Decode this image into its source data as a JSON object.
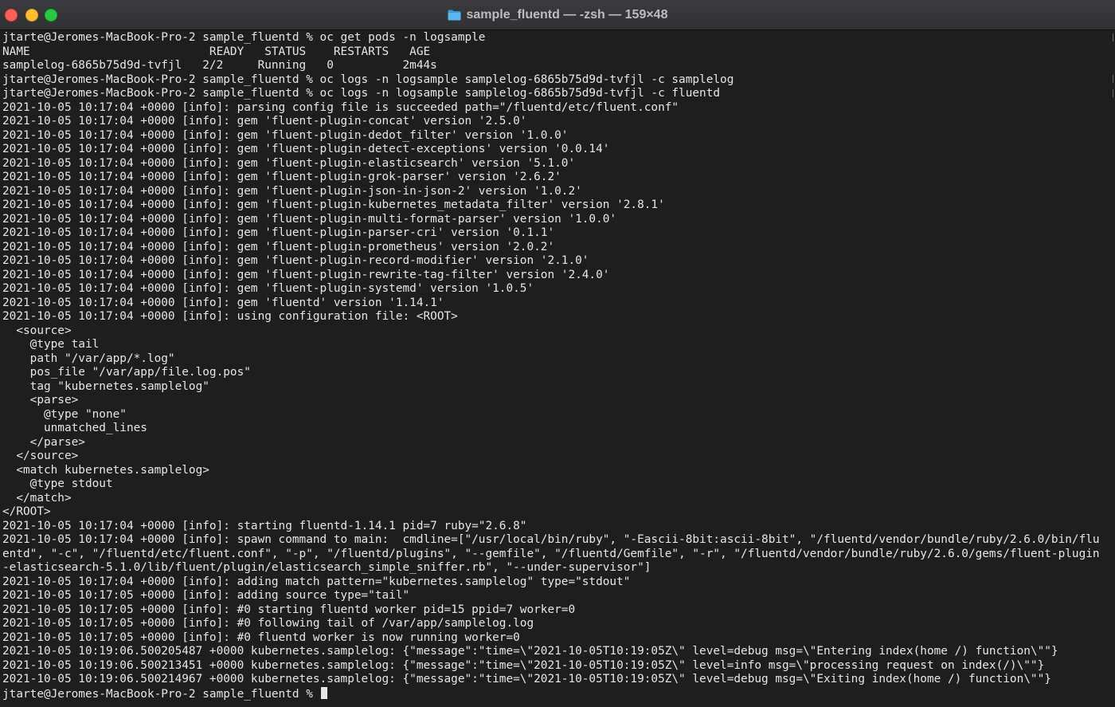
{
  "window": {
    "title": "sample_fluentd — -zsh — 159×48",
    "folder_icon": "folder-icon",
    "title_color": "#bdbdbd",
    "background": "#1e1e1e",
    "text_color": "#e6e6e6"
  },
  "terminal": {
    "lines": [
      "jtarte@Jeromes-MacBook-Pro-2 sample_fluentd % oc get pods -n logsample",
      "NAME                          READY   STATUS    RESTARTS   AGE",
      "samplelog-6865b75d9d-tvfjl   2/2     Running   0          2m44s",
      "jtarte@Jeromes-MacBook-Pro-2 sample_fluentd % oc logs -n logsample samplelog-6865b75d9d-tvfjl -c samplelog",
      "jtarte@Jeromes-MacBook-Pro-2 sample_fluentd % oc logs -n logsample samplelog-6865b75d9d-tvfjl -c fluentd",
      "2021-10-05 10:17:04 +0000 [info]: parsing config file is succeeded path=\"/fluentd/etc/fluent.conf\"",
      "2021-10-05 10:17:04 +0000 [info]: gem 'fluent-plugin-concat' version '2.5.0'",
      "2021-10-05 10:17:04 +0000 [info]: gem 'fluent-plugin-dedot_filter' version '1.0.0'",
      "2021-10-05 10:17:04 +0000 [info]: gem 'fluent-plugin-detect-exceptions' version '0.0.14'",
      "2021-10-05 10:17:04 +0000 [info]: gem 'fluent-plugin-elasticsearch' version '5.1.0'",
      "2021-10-05 10:17:04 +0000 [info]: gem 'fluent-plugin-grok-parser' version '2.6.2'",
      "2021-10-05 10:17:04 +0000 [info]: gem 'fluent-plugin-json-in-json-2' version '1.0.2'",
      "2021-10-05 10:17:04 +0000 [info]: gem 'fluent-plugin-kubernetes_metadata_filter' version '2.8.1'",
      "2021-10-05 10:17:04 +0000 [info]: gem 'fluent-plugin-multi-format-parser' version '1.0.0'",
      "2021-10-05 10:17:04 +0000 [info]: gem 'fluent-plugin-parser-cri' version '0.1.1'",
      "2021-10-05 10:17:04 +0000 [info]: gem 'fluent-plugin-prometheus' version '2.0.2'",
      "2021-10-05 10:17:04 +0000 [info]: gem 'fluent-plugin-record-modifier' version '2.1.0'",
      "2021-10-05 10:17:04 +0000 [info]: gem 'fluent-plugin-rewrite-tag-filter' version '2.4.0'",
      "2021-10-05 10:17:04 +0000 [info]: gem 'fluent-plugin-systemd' version '1.0.5'",
      "2021-10-05 10:17:04 +0000 [info]: gem 'fluentd' version '1.14.1'",
      "2021-10-05 10:17:04 +0000 [info]: using configuration file: <ROOT>",
      "  <source>",
      "    @type tail",
      "    path \"/var/app/*.log\"",
      "    pos_file \"/var/app/file.log.pos\"",
      "    tag \"kubernetes.samplelog\"",
      "    <parse>",
      "      @type \"none\"",
      "      unmatched_lines",
      "    </parse>",
      "  </source>",
      "  <match kubernetes.samplelog>",
      "    @type stdout",
      "  </match>",
      "</ROOT>",
      "2021-10-05 10:17:04 +0000 [info]: starting fluentd-1.14.1 pid=7 ruby=\"2.6.8\"",
      "2021-10-05 10:17:04 +0000 [info]: spawn command to main:  cmdline=[\"/usr/local/bin/ruby\", \"-Eascii-8bit:ascii-8bit\", \"/fluentd/vendor/bundle/ruby/2.6.0/bin/flu",
      "entd\", \"-c\", \"/fluentd/etc/fluent.conf\", \"-p\", \"/fluentd/plugins\", \"--gemfile\", \"/fluentd/Gemfile\", \"-r\", \"/fluentd/vendor/bundle/ruby/2.6.0/gems/fluent-plugin",
      "-elasticsearch-5.1.0/lib/fluent/plugin/elasticsearch_simple_sniffer.rb\", \"--under-supervisor\"]",
      "2021-10-05 10:17:04 +0000 [info]: adding match pattern=\"kubernetes.samplelog\" type=\"stdout\"",
      "2021-10-05 10:17:05 +0000 [info]: adding source type=\"tail\"",
      "2021-10-05 10:17:05 +0000 [info]: #0 starting fluentd worker pid=15 ppid=7 worker=0",
      "2021-10-05 10:17:05 +0000 [info]: #0 following tail of /var/app/samplelog.log",
      "2021-10-05 10:17:05 +0000 [info]: #0 fluentd worker is now running worker=0",
      "2021-10-05 10:19:06.500205487 +0000 kubernetes.samplelog: {\"message\":\"time=\\\"2021-10-05T10:19:05Z\\\" level=debug msg=\\\"Entering index(home /) function\\\"\"}",
      "2021-10-05 10:19:06.500213451 +0000 kubernetes.samplelog: {\"message\":\"time=\\\"2021-10-05T10:19:05Z\\\" level=info msg=\\\"processing request on index(/)\\\"\"}",
      "2021-10-05 10:19:06.500214967 +0000 kubernetes.samplelog: {\"message\":\"time=\\\"2021-10-05T10:19:05Z\\\" level=debug msg=\\\"Exiting index(home /) function\\\"\"}"
    ],
    "prompt": "jtarte@Jeromes-MacBook-Pro-2 sample_fluentd % "
  }
}
